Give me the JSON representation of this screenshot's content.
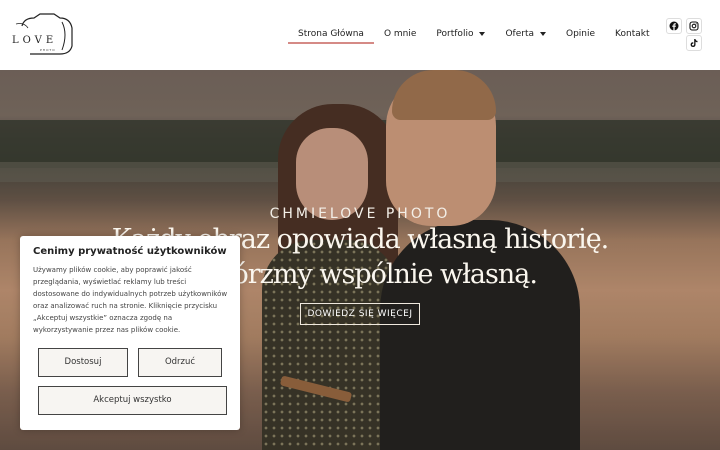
{
  "logo": {
    "text": "LOVE",
    "small": "PHOTO"
  },
  "nav": {
    "items": [
      {
        "label": "Strona Główna",
        "active": true,
        "dropdown": false
      },
      {
        "label": "O mnie",
        "active": false,
        "dropdown": false
      },
      {
        "label": "Portfolio",
        "active": false,
        "dropdown": true
      },
      {
        "label": "Oferta",
        "active": false,
        "dropdown": true
      },
      {
        "label": "Opinie",
        "active": false,
        "dropdown": false
      },
      {
        "label": "Kontakt",
        "active": false,
        "dropdown": false
      }
    ]
  },
  "social": [
    "facebook-icon",
    "instagram-icon",
    "tiktok-icon"
  ],
  "hero": {
    "subtitle": "CHMIELOVE PHOTO",
    "title_line1": "Każdy obraz opowiada własną historię.",
    "title_line2": "Stwórzmy wspólnie własną.",
    "cta": "DOWIEDZ SIĘ WIĘCEJ"
  },
  "cookie": {
    "title": "Cenimy prywatność użytkowników",
    "text": "Używamy plików cookie, aby poprawić jakość przeglądania, wyświetlać reklamy lub treści dostosowane do indywidualnych potrzeb użytkowników oraz analizować ruch na stronie. Kliknięcie przycisku „Akceptuj wszystkie” oznacza zgodę na wykorzystywanie przez nas plików cookie.",
    "customize": "Dostosuj",
    "reject": "Odrzuć",
    "accept": "Akceptuj wszystko"
  },
  "colors": {
    "accent": "#d58a86",
    "text": "#222222"
  }
}
